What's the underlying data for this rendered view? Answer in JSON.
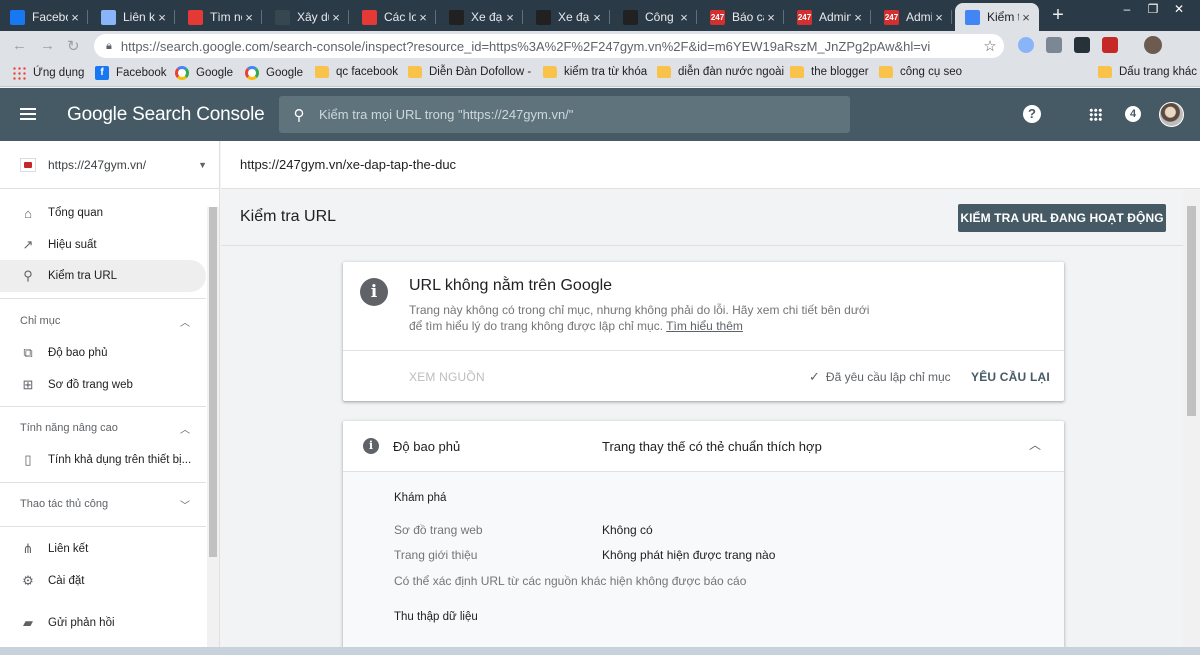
{
  "browser": {
    "tabs": [
      {
        "title": "Facebo",
        "fav": "#1877f2"
      },
      {
        "title": "Liên kế",
        "fav": "#8ab4f8"
      },
      {
        "title": "Tìm nơ",
        "fav": "#e53935"
      },
      {
        "title": "Xây dự",
        "fav": "#37474f"
      },
      {
        "title": "Các lo",
        "fav": "#e53935"
      },
      {
        "title": "Xe đạp",
        "fav": "#212121"
      },
      {
        "title": "Xe đạp",
        "fav": "#212121"
      },
      {
        "title": "Công t",
        "fav": "#212121"
      },
      {
        "title": "Báo cá",
        "fav": "#d32f2f",
        "badge": "247"
      },
      {
        "title": "Admin",
        "fav": "#d32f2f",
        "badge": "247"
      },
      {
        "title": "Admin",
        "fav": "#d32f2f",
        "badge": "247"
      },
      {
        "title": "Kiểm t",
        "fav": "#4285f4",
        "active": true
      }
    ],
    "url": "https://search.google.com/search-console/inspect?resource_id=https%3A%2F%2F247gym.vn%2F&id=m6YEW19aRszM_JnZPg2pAw&hl=vi",
    "bookmarks": [
      {
        "label": "Ứng dụng",
        "icon": "apps"
      },
      {
        "label": "Facebook",
        "icon": "fb"
      },
      {
        "label": "Google",
        "icon": "gg"
      },
      {
        "label": "Google",
        "icon": "gg"
      },
      {
        "label": "qc facebook",
        "icon": "folder"
      },
      {
        "label": "Diễn Đàn Dofollow -",
        "icon": "folder"
      },
      {
        "label": "kiểm tra từ khóa",
        "icon": "folder"
      },
      {
        "label": "diễn đàn nước ngoài",
        "icon": "folder"
      },
      {
        "label": "the blogger",
        "icon": "folder"
      },
      {
        "label": "công cụ seo",
        "icon": "folder"
      },
      {
        "label": "Dấu trang khác",
        "icon": "folder"
      }
    ]
  },
  "app": {
    "brand": "Google Search Console",
    "search_placeholder": "Kiểm tra mọi URL trong \"https://247gym.vn/\"",
    "help": "?",
    "notification_count": "4",
    "accent_color": "#455a64"
  },
  "sidebar": {
    "property": "https://247gym.vn/",
    "items": [
      {
        "label": "Tổng quan",
        "icon": "home-icon"
      },
      {
        "label": "Hiệu suất",
        "icon": "trending-up-icon"
      },
      {
        "label": "Kiểm tra URL",
        "icon": "search-icon"
      }
    ],
    "index_section": "Chỉ mục",
    "index_items": [
      {
        "label": "Độ bao phủ",
        "icon": "coverage-icon"
      },
      {
        "label": "Sơ đồ trang web",
        "icon": "sitemap-icon"
      }
    ],
    "enhancements_section": "Tính năng nâng cao",
    "enhancements_items": [
      {
        "label": "Tính khả dụng trên thiết bị...",
        "icon": "phone-icon"
      }
    ],
    "manual_section": "Thao tác thủ công",
    "bottom_items": [
      {
        "label": "Liên kết",
        "icon": "links-icon"
      },
      {
        "label": "Cài đặt",
        "icon": "gear-icon"
      },
      {
        "label": "Gửi phản hồi",
        "icon": "feedback-icon"
      }
    ]
  },
  "main": {
    "inspected_url": "https://247gym.vn/xe-dap-tap-the-duc",
    "title": "Kiểm tra URL",
    "live_test_button": "KIỂM TRA URL ĐANG HOẠT ĐỘNG",
    "status": {
      "title": "URL không nằm trên Google",
      "description": "Trang này không có trong chỉ mục, nhưng không phải do lỗi. Hãy xem chi tiết bên dưới để tìm hiểu lý do trang không được lập chỉ mục.",
      "learn_more": "Tìm hiểu thêm",
      "view_source": "XEM NGUỒN",
      "requested": "Đã yêu cầu lập chỉ mục",
      "request_again": "YÊU CẦU LẠI"
    },
    "coverage": {
      "label": "Độ bao phủ",
      "value": "Trang thay thế có thẻ chuẩn thích hợp",
      "discovery_heading": "Khám phá",
      "sitemap_label": "Sơ đồ trang web",
      "sitemap_value": "Không có",
      "referring_label": "Trang giới thiệu",
      "referring_value": "Không phát hiện được trang nào",
      "other_sources_note": "Có thể xác định URL từ các nguồn khác hiện không được báo cáo",
      "crawl_heading": "Thu thập dữ liệu"
    }
  }
}
